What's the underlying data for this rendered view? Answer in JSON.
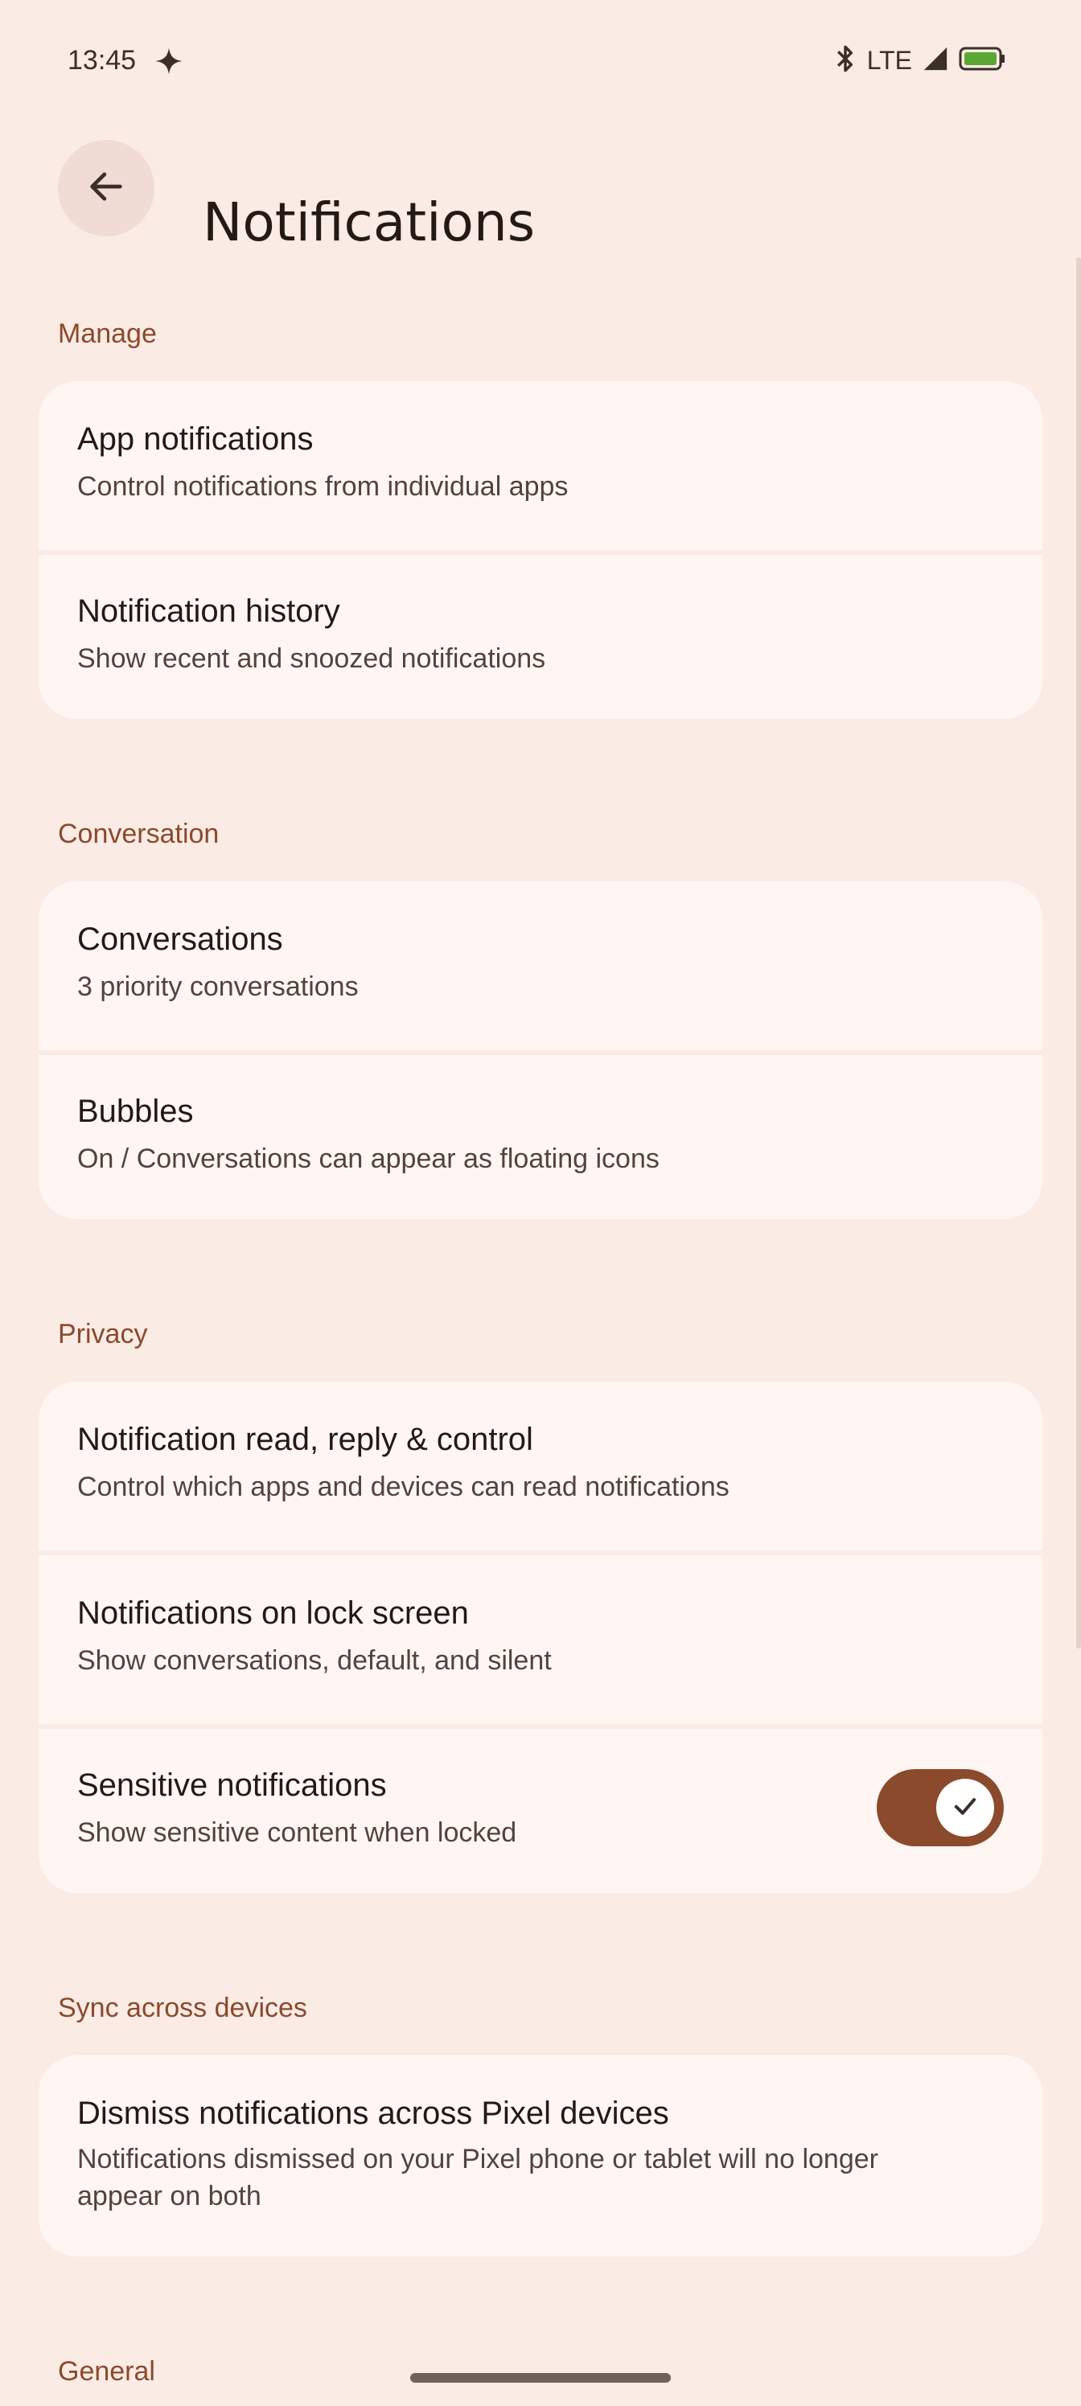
{
  "status_bar": {
    "time": "13:45",
    "network": "LTE",
    "icons": [
      "sparkle-icon",
      "bluetooth-icon",
      "signal-icon",
      "battery-icon"
    ]
  },
  "app_bar": {
    "back_icon": "arrow-back-icon",
    "title": "Notifications"
  },
  "sections": {
    "manage": {
      "header": "Manage",
      "items": [
        {
          "title": "App notifications",
          "subtitle": "Control notifications from individual apps"
        },
        {
          "title": "Notification history",
          "subtitle": "Show recent and snoozed notifications"
        }
      ]
    },
    "conversation": {
      "header": "Conversation",
      "items": [
        {
          "title": "Conversations",
          "subtitle": "3 priority conversations"
        },
        {
          "title": "Bubbles",
          "subtitle": "On / Conversations can appear as floating icons"
        }
      ]
    },
    "privacy": {
      "header": "Privacy",
      "items": [
        {
          "title": "Notification read, reply & control",
          "subtitle": "Control which apps and devices can read notifications"
        },
        {
          "title": "Notifications on lock screen",
          "subtitle": "Show conversations, default, and silent"
        },
        {
          "title": "Sensitive notifications",
          "subtitle": "Show sensitive content when locked",
          "toggle_on": true
        }
      ]
    },
    "sync": {
      "header": "Sync across devices",
      "items": [
        {
          "title": "Dismiss notifications across Pixel devices",
          "subtitle": "Notifications dismissed on your Pixel phone or tablet will no longer appear on both"
        }
      ]
    },
    "general": {
      "header": "General"
    }
  },
  "colors": {
    "background": "#fbebe5",
    "card": "#fff6f3",
    "accent": "#8b4a2b"
  }
}
